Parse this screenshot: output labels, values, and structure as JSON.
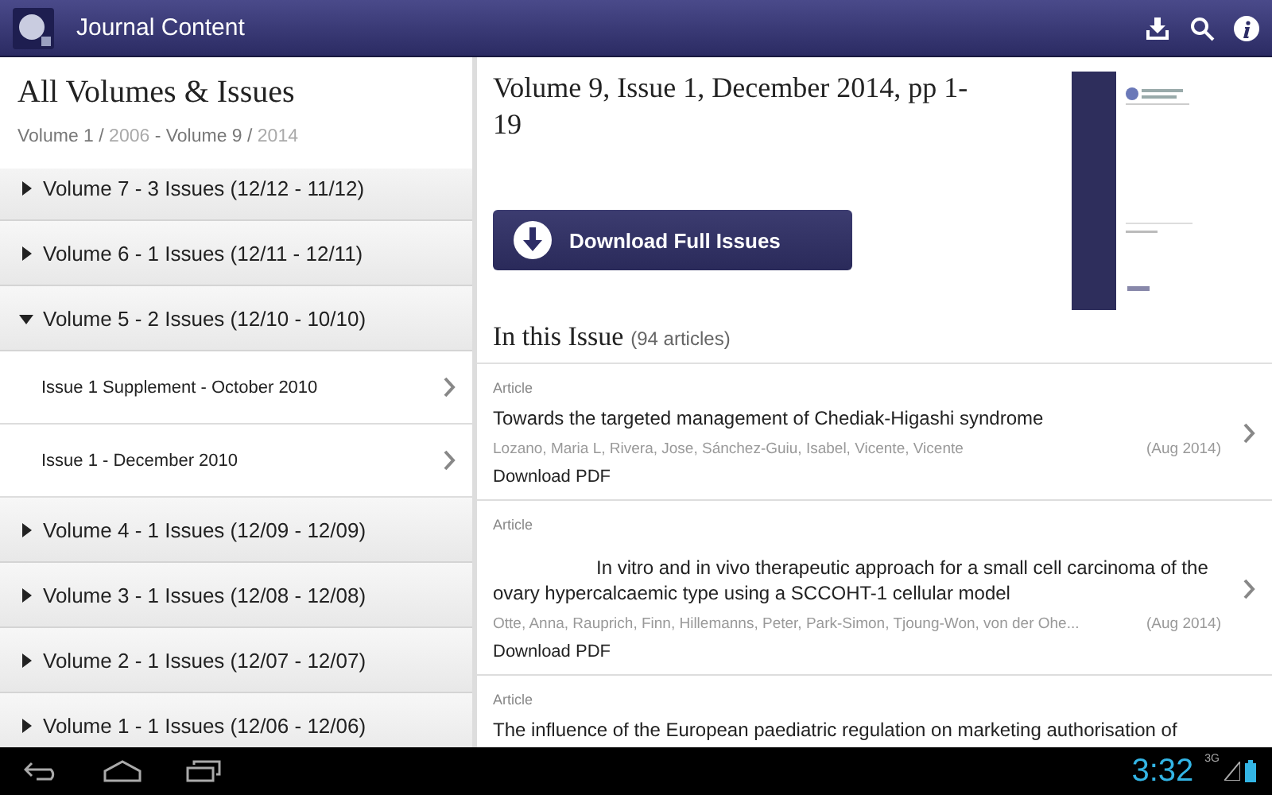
{
  "app_bar": {
    "title": "Journal Content"
  },
  "sidebar": {
    "title": "All Volumes & Issues",
    "subtitle_parts": [
      {
        "text": "Volume 1 / ",
        "kind": "dark"
      },
      {
        "text": "2006",
        "kind": "light"
      },
      {
        "text": " - Volume 9 / ",
        "kind": "dark"
      },
      {
        "text": "2014",
        "kind": "light"
      }
    ],
    "volumes": [
      {
        "label": "Volume 7 - 3 Issues (12/12  -  11/12)",
        "expanded": false
      },
      {
        "label": "Volume 6 - 1 Issues (12/11  -  12/11)",
        "expanded": false
      },
      {
        "label": "Volume 5 - 2 Issues (12/10  -  10/10)",
        "expanded": true,
        "children": [
          {
            "label": "Issue 1 Supplement - October 2010"
          },
          {
            "label": "Issue 1 - December 2010"
          }
        ]
      },
      {
        "label": "Volume 4 - 1 Issues (12/09  -  12/09)",
        "expanded": false
      },
      {
        "label": "Volume 3 - 1 Issues (12/08  -  12/08)",
        "expanded": false
      },
      {
        "label": "Volume 2 - 1 Issues (12/07  -  12/07)",
        "expanded": false
      },
      {
        "label": "Volume 1 - 1 Issues (12/06  -  12/06)",
        "expanded": false
      }
    ]
  },
  "issue": {
    "title": "Volume 9, Issue 1, December 2014, pp 1-19",
    "download_button": "Download Full Issues",
    "section_title": "In this Issue",
    "article_count": "(94 articles)"
  },
  "articles": [
    {
      "type": "Article",
      "title": "Towards the targeted management of Chediak-Higashi syndrome",
      "indented": false,
      "authors": "Lozano, Maria L, Rivera, Jose, Sánchez-Guiu, Isabel, Vicente, Vicente",
      "date": "(Aug 2014)",
      "download": "Download PDF"
    },
    {
      "type": "Article",
      "title": "In vitro and in vivo therapeutic approach for a small cell carcinoma of the ovary hypercalcaemic type using a SCCOHT-1 cellular model",
      "indented": true,
      "authors": "Otte, Anna, Rauprich, Finn, Hillemanns, Peter, Park-Simon, Tjoung-Won, von der Ohe...",
      "date": "(Aug 2014)",
      "download": "Download PDF"
    },
    {
      "type": "Article",
      "title": "The influence of the European paediatric regulation on marketing authorisation of"
    }
  ],
  "status_bar": {
    "time": "3:32",
    "network": "3G"
  }
}
